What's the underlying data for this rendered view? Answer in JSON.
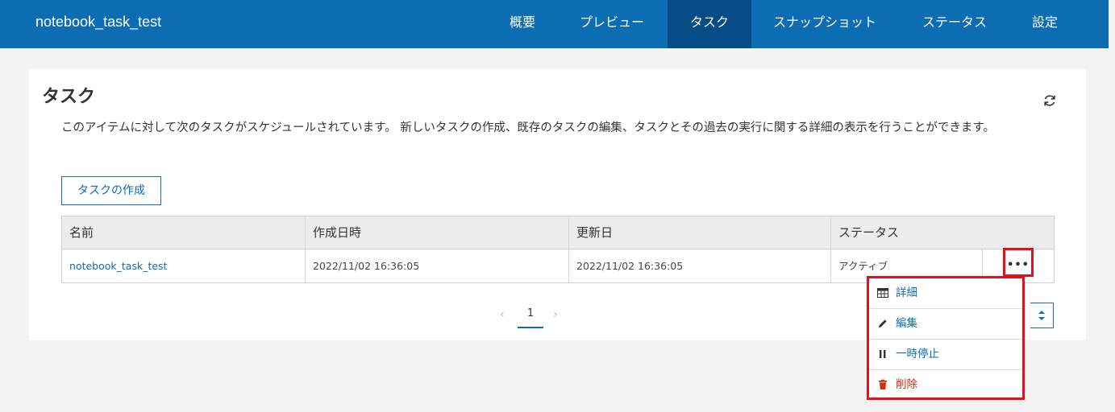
{
  "app": {
    "title": "notebook_task_test"
  },
  "nav": {
    "items": [
      {
        "label": "概要"
      },
      {
        "label": "プレビュー"
      },
      {
        "label": "タスク"
      },
      {
        "label": "スナップショット"
      },
      {
        "label": "ステータス"
      },
      {
        "label": "設定"
      }
    ],
    "active": "タスク"
  },
  "main": {
    "title": "タスク",
    "description": "このアイテムに対して次のタスクがスケジュールされています。 新しいタスクの作成、既存のタスクの編集、タスクとその過去の実行に関する詳細の表示を行うことができます。",
    "create_button": "タスクの作成"
  },
  "table": {
    "columns": [
      "名前",
      "作成日時",
      "更新日",
      "ステータス"
    ],
    "rows": [
      {
        "name": "notebook_task_test",
        "created": "2022/11/02 16:36:05",
        "updated": "2022/11/02 16:36:05",
        "status": "アクティブ",
        "more": "•••"
      }
    ]
  },
  "pagination": {
    "prev": "‹",
    "current": "1",
    "next": "›"
  },
  "context_menu": {
    "items": [
      {
        "label": "詳細",
        "icon": "table-icon"
      },
      {
        "label": "編集",
        "icon": "pencil-icon"
      },
      {
        "label": "一時停止",
        "icon": "pause-icon"
      },
      {
        "label": "削除",
        "icon": "trash-icon"
      }
    ]
  },
  "colors": {
    "brand": "#0d6db3",
    "nav_active": "#074c86",
    "highlight": "#e0121f",
    "danger": "#d2310f"
  }
}
